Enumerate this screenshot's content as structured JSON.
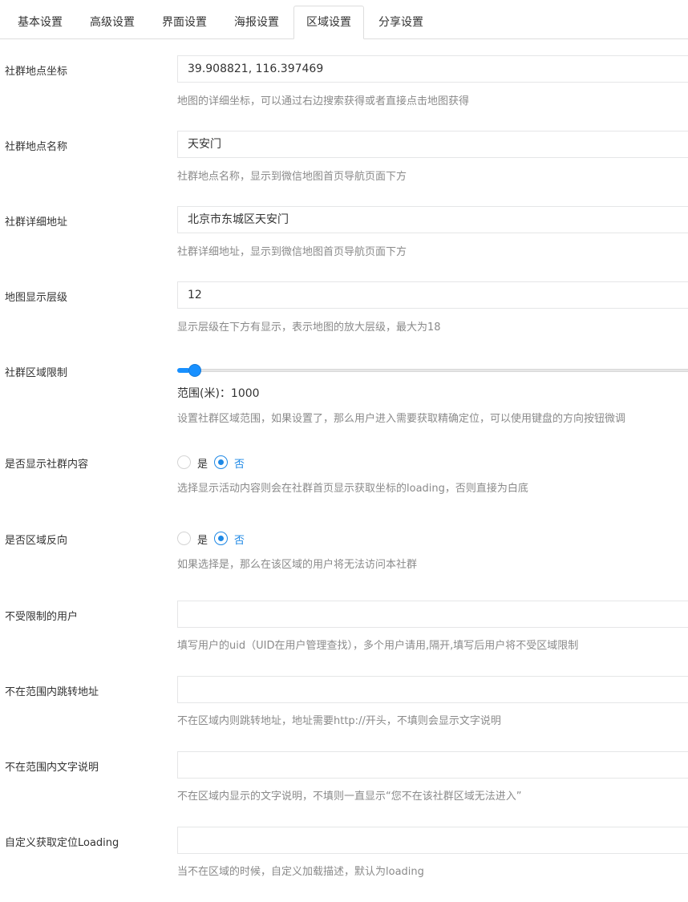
{
  "tabs": [
    {
      "label": "基本设置"
    },
    {
      "label": "高级设置"
    },
    {
      "label": "界面设置"
    },
    {
      "label": "海报设置"
    },
    {
      "label": "区域设置",
      "active": true
    },
    {
      "label": "分享设置"
    }
  ],
  "fields": {
    "coords": {
      "label": "社群地点坐标",
      "value": "39.908821, 116.397469",
      "help": "地图的详细坐标，可以通过右边搜索获得或者直接点击地图获得"
    },
    "place_name": {
      "label": "社群地点名称",
      "value": "天安门",
      "help": "社群地点名称，显示到微信地图首页导航页面下方"
    },
    "address": {
      "label": "社群详细地址",
      "value": "北京市东城区天安门",
      "help": "社群详细地址，显示到微信地图首页导航页面下方"
    },
    "zoom": {
      "label": "地图显示层级",
      "value": "12",
      "help": "显示层级在下方有显示，表示地图的放大层级，最大为18"
    },
    "region_limit": {
      "label": "社群区域限制",
      "range_text": "范围(米)：1000",
      "slider_fraction": 0.025,
      "help": "设置社群区域范围，如果设置了，那么用户进入需要获取精确定位，可以使用键盘的方向按钮微调"
    },
    "show_content": {
      "label": "是否显示社群内容",
      "option_yes": "是",
      "option_no": "否",
      "selected": "否",
      "help": "选择显示活动内容则会在社群首页显示获取坐标的loading，否则直接为白底"
    },
    "region_reverse": {
      "label": "是否区域反向",
      "option_yes": "是",
      "option_no": "否",
      "selected": "否",
      "help": "如果选择是，那么在该区域的用户将无法访问本社群"
    },
    "unlimited_users": {
      "label": "不受限制的用户",
      "value": "",
      "help": "填写用户的uid（UID在用户管理查找），多个用户请用,隔开,填写后用户将不受区域限制"
    },
    "redirect_url": {
      "label": "不在范围内跳转地址",
      "value": "",
      "help": "不在区域内则跳转地址，地址需要http://开头，不填则会显示文字说明"
    },
    "out_text": {
      "label": "不在范围内文字说明",
      "value": "",
      "help": "不在区域内显示的文字说明，不填则一直显示“您不在该社群区域无法进入”"
    },
    "loading": {
      "label": "自定义获取定位Loading",
      "value": "",
      "help": "当不在区域的时候，自定义加载描述，默认为loading"
    }
  },
  "colors": {
    "accent": "#1890ff",
    "radio": "#1e88e5",
    "help_text": "#8a8a8a",
    "border": "#e5e6e7"
  }
}
